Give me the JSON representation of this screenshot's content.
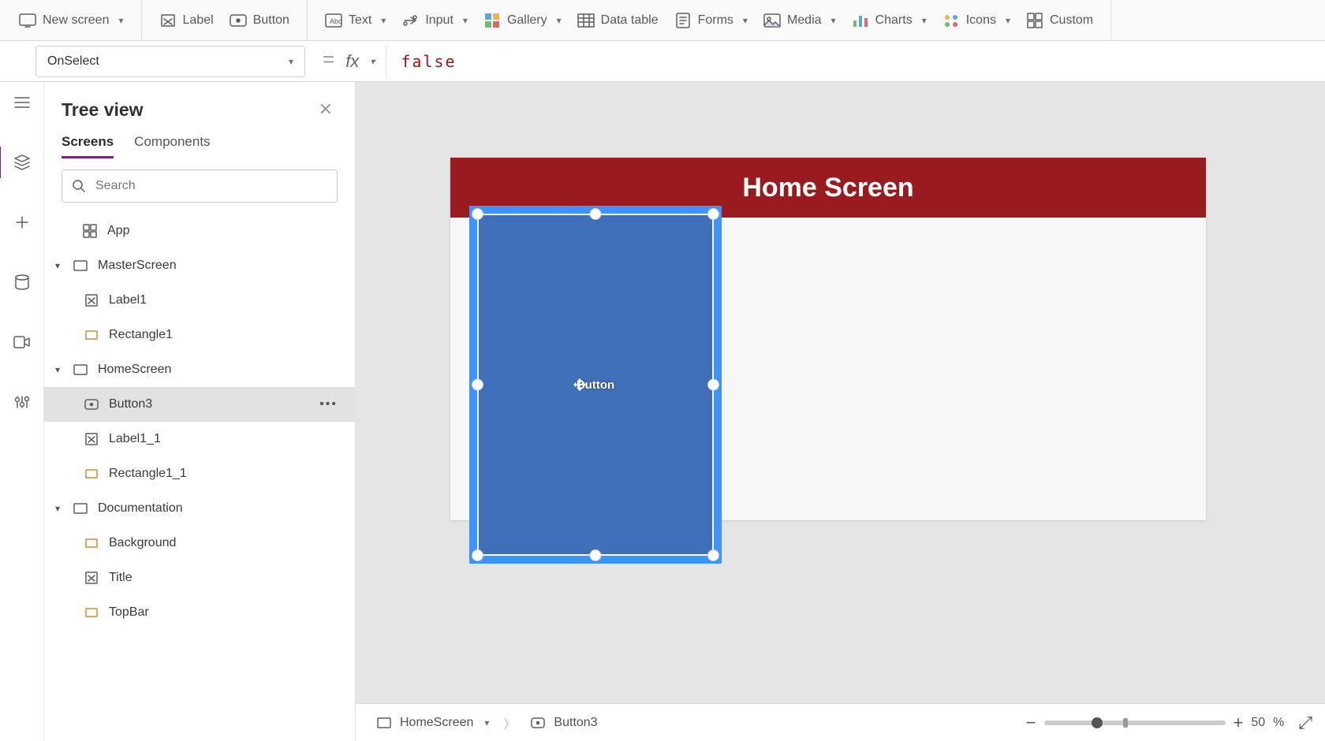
{
  "ribbon": {
    "new_screen": "New screen",
    "label": "Label",
    "button": "Button",
    "text": "Text",
    "input": "Input",
    "gallery": "Gallery",
    "data_table": "Data table",
    "forms": "Forms",
    "media": "Media",
    "charts": "Charts",
    "icons": "Icons",
    "custom": "Custom"
  },
  "formula": {
    "property": "OnSelect",
    "eq": "=",
    "fx": "fx",
    "value": "false"
  },
  "tree": {
    "title": "Tree view",
    "tab_screens": "Screens",
    "tab_components": "Components",
    "search_placeholder": "Search",
    "nodes": {
      "app": "App",
      "master_screen": "MasterScreen",
      "label1": "Label1",
      "rectangle1": "Rectangle1",
      "home_screen": "HomeScreen",
      "button3": "Button3",
      "label1_1": "Label1_1",
      "rectangle1_1": "Rectangle1_1",
      "documentation": "Documentation",
      "background": "Background",
      "title": "Title",
      "topbar": "TopBar"
    }
  },
  "canvas": {
    "header": "Home Screen",
    "button_text": "Button"
  },
  "breadcrumb": {
    "screen": "HomeScreen",
    "item": "Button3"
  },
  "zoom": {
    "value": "50",
    "unit": "%"
  }
}
